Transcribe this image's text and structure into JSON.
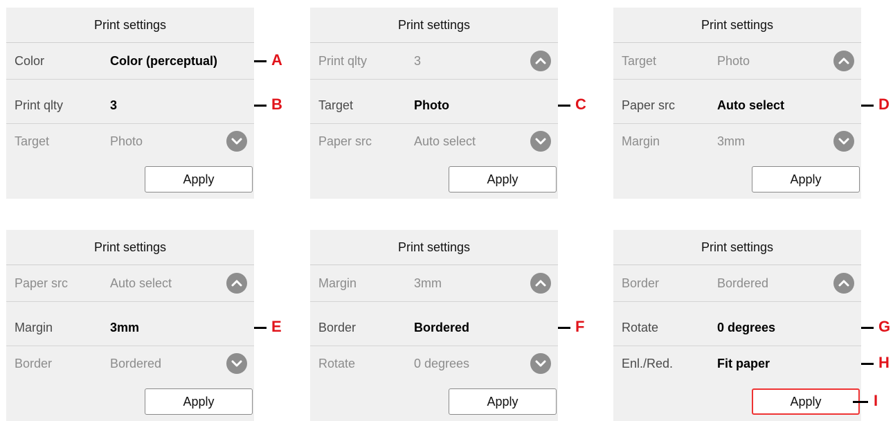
{
  "panels": [
    {
      "title": "Print settings",
      "rows": [
        {
          "label": "Color",
          "value": "Color (perceptual)",
          "state": "active",
          "callout": "A"
        },
        {
          "label": "Print qlty",
          "value": "3",
          "state": "active",
          "callout": "B"
        },
        {
          "label": "Target",
          "value": "Photo",
          "state": "dim",
          "chevron": "down"
        }
      ],
      "apply_label": "Apply"
    },
    {
      "title": "Print settings",
      "rows": [
        {
          "label": "Print qlty",
          "value": "3",
          "state": "dim",
          "chevron": "up"
        },
        {
          "label": "Target",
          "value": "Photo",
          "state": "active",
          "callout": "C"
        },
        {
          "label": "Paper src",
          "value": "Auto select",
          "state": "dim",
          "chevron": "down"
        }
      ],
      "apply_label": "Apply"
    },
    {
      "title": "Print settings",
      "rows": [
        {
          "label": "Target",
          "value": "Photo",
          "state": "dim",
          "chevron": "up"
        },
        {
          "label": "Paper src",
          "value": "Auto select",
          "state": "active",
          "callout": "D"
        },
        {
          "label": "Margin",
          "value": "3mm",
          "state": "dim",
          "chevron": "down"
        }
      ],
      "apply_label": "Apply"
    },
    {
      "title": "Print settings",
      "rows": [
        {
          "label": "Paper src",
          "value": "Auto select",
          "state": "dim",
          "chevron": "up"
        },
        {
          "label": "Margin",
          "value": "3mm",
          "state": "active",
          "callout": "E"
        },
        {
          "label": "Border",
          "value": "Bordered",
          "state": "dim",
          "chevron": "down"
        }
      ],
      "apply_label": "Apply"
    },
    {
      "title": "Print settings",
      "rows": [
        {
          "label": "Margin",
          "value": "3mm",
          "state": "dim",
          "chevron": "up"
        },
        {
          "label": "Border",
          "value": "Bordered",
          "state": "active",
          "callout": "F"
        },
        {
          "label": "Rotate",
          "value": "0 degrees",
          "state": "dim",
          "chevron": "down"
        }
      ],
      "apply_label": "Apply"
    },
    {
      "title": "Print settings",
      "rows": [
        {
          "label": "Border",
          "value": "Bordered",
          "state": "dim",
          "chevron": "up"
        },
        {
          "label": "Rotate",
          "value": "0 degrees",
          "state": "active",
          "callout": "G"
        },
        {
          "label": "Enl./Red.",
          "value": "Fit paper",
          "state": "active",
          "callout": "H"
        }
      ],
      "apply_label": "Apply",
      "apply_callout": "I",
      "apply_highlight": true
    }
  ],
  "colors": {
    "panel_bg": "#f0f0f0",
    "callout_text": "#e1141b",
    "highlight_border": "#e33"
  }
}
